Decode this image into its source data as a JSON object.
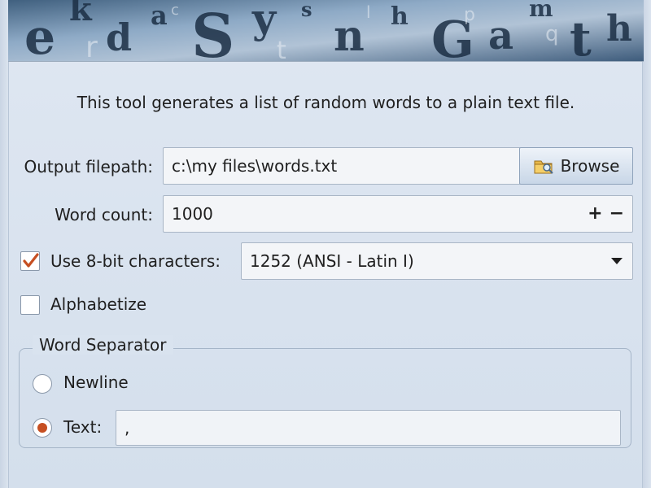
{
  "description": "This tool generates a list of random words to a plain text file.",
  "output": {
    "label": "Output filepath:",
    "value": "c:\\my files\\words.txt",
    "browse_label": "Browse"
  },
  "word_count": {
    "label": "Word count:",
    "value": "1000",
    "plus": "+",
    "minus": "−"
  },
  "eight_bit": {
    "label": "Use 8-bit characters:",
    "checked": true,
    "encoding": "1252 (ANSI - Latin I)"
  },
  "alphabetize": {
    "label": "Alphabetize",
    "checked": false
  },
  "separator": {
    "title": "Word Separator",
    "newline_label": "Newline",
    "text_label": "Text:",
    "text_value": ",",
    "selected": "text"
  },
  "colors": {
    "accent": "#c64f22",
    "background": "#d7e1ee"
  },
  "icons": {
    "browse": "folder-search-icon",
    "check": "checkmark-icon",
    "dropdown": "chevron-down-icon"
  }
}
